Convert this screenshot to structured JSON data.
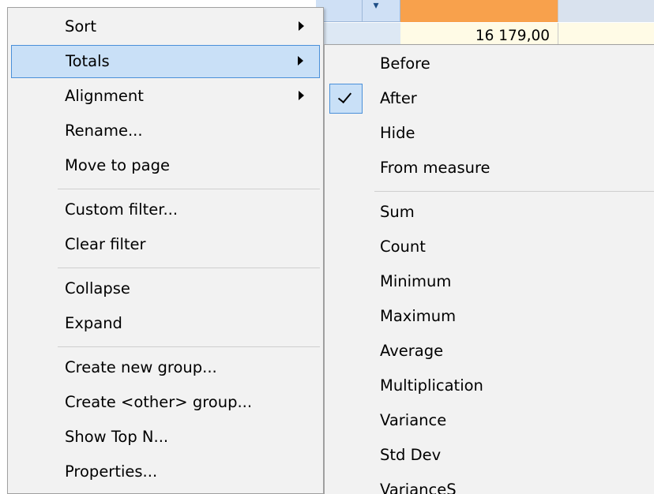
{
  "grid": {
    "cell_value": "16 179,00"
  },
  "context_menu": {
    "items": [
      {
        "label": "Sort"
      },
      {
        "label": "Totals"
      },
      {
        "label": "Alignment"
      },
      {
        "label": "Rename..."
      },
      {
        "label": "Move to page"
      },
      {
        "label": "Custom filter..."
      },
      {
        "label": "Clear filter"
      },
      {
        "label": "Collapse"
      },
      {
        "label": "Expand"
      },
      {
        "label": "Create new group..."
      },
      {
        "label": "Create <other> group..."
      },
      {
        "label": "Show Top N..."
      },
      {
        "label": "Properties..."
      }
    ]
  },
  "totals_submenu": {
    "items": [
      {
        "label": "Before"
      },
      {
        "label": "After"
      },
      {
        "label": "Hide"
      },
      {
        "label": "From measure"
      },
      {
        "label": "Sum"
      },
      {
        "label": "Count"
      },
      {
        "label": "Minimum"
      },
      {
        "label": "Maximum"
      },
      {
        "label": "Average"
      },
      {
        "label": "Multiplication"
      },
      {
        "label": "Variance"
      },
      {
        "label": "Std Dev"
      },
      {
        "label": "VarianceS"
      }
    ],
    "checked_item": "After"
  },
  "colors": {
    "highlight": "#c9e0f7",
    "highlight_border": "#4a90d9",
    "header_orange": "#f8a14c",
    "menu_background": "#f2f2f2"
  }
}
